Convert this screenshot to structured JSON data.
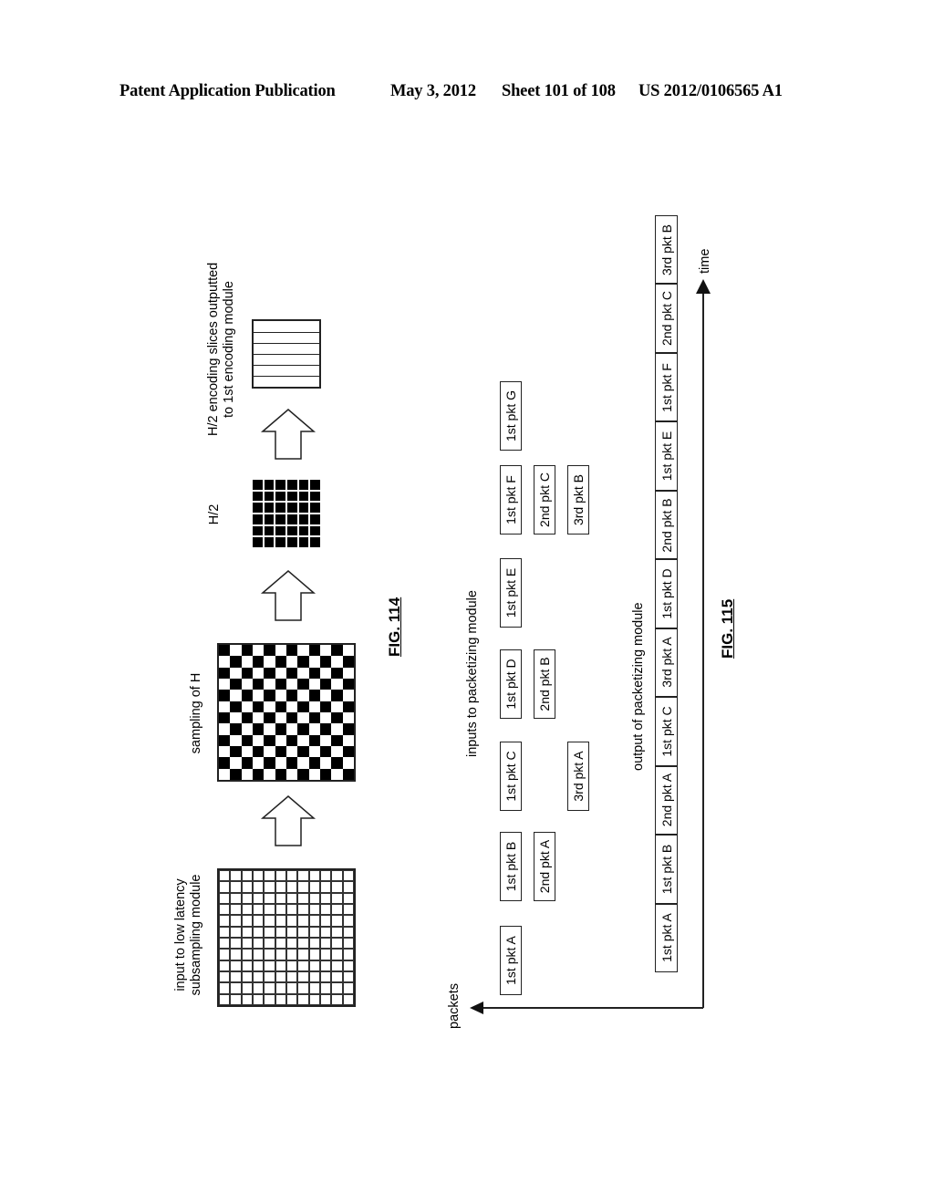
{
  "header": {
    "publication": "Patent Application Publication",
    "date": "May 3, 2012",
    "sheet": "Sheet 101 of 108",
    "number": "US 2012/0106565 A1"
  },
  "fig114": {
    "label": "FIG. 114",
    "stages": [
      {
        "id": "input",
        "label_line1": "input to low latency",
        "label_line2": "subsampling module",
        "pattern": "grid",
        "size": 12
      },
      {
        "id": "sampling",
        "label_line1": "sampling of H",
        "label_line2": "",
        "pattern": "checkerboard",
        "size": 12
      },
      {
        "id": "half",
        "label_line1": "H/2",
        "label_line2": "",
        "pattern": "solid-grid",
        "size": 6
      },
      {
        "id": "slices",
        "label_line1": "H/2 encoding slices outputted",
        "label_line2": "to 1st encoding module",
        "pattern": "slices",
        "size": 6
      }
    ]
  },
  "fig115": {
    "label": "FIG. 115",
    "inputs_label": "inputs to packetizing module",
    "output_label": "output of packetizing module",
    "axis_y_label": "packets",
    "axis_x_label": "time",
    "inputs": [
      {
        "text": "1st pkt A",
        "row": 0,
        "col": 0
      },
      {
        "text": "1st pkt B",
        "row": 0,
        "col": 1
      },
      {
        "text": "2nd pkt A",
        "row": 1,
        "col": 1
      },
      {
        "text": "1st pkt C",
        "row": 0,
        "col": 2
      },
      {
        "text": "3rd pkt A",
        "row": 2,
        "col": 2
      },
      {
        "text": "1st pkt D",
        "row": 0,
        "col": 3
      },
      {
        "text": "2nd pkt B",
        "row": 1,
        "col": 3
      },
      {
        "text": "1st pkt E",
        "row": 0,
        "col": 4
      },
      {
        "text": "1st pkt F",
        "row": 0,
        "col": 5
      },
      {
        "text": "2nd pkt C",
        "row": 1,
        "col": 5
      },
      {
        "text": "3rd pkt B",
        "row": 2,
        "col": 5
      },
      {
        "text": "1st pkt G",
        "row": 0,
        "col": 6
      }
    ],
    "outputs": [
      "1st pkt A",
      "1st pkt B",
      "2nd pkt A",
      "1st pkt C",
      "3rd pkt A",
      "1st pkt D",
      "2nd pkt B",
      "1st pkt E",
      "1st pkt F",
      "2nd pkt C",
      "3rd pkt B"
    ]
  }
}
